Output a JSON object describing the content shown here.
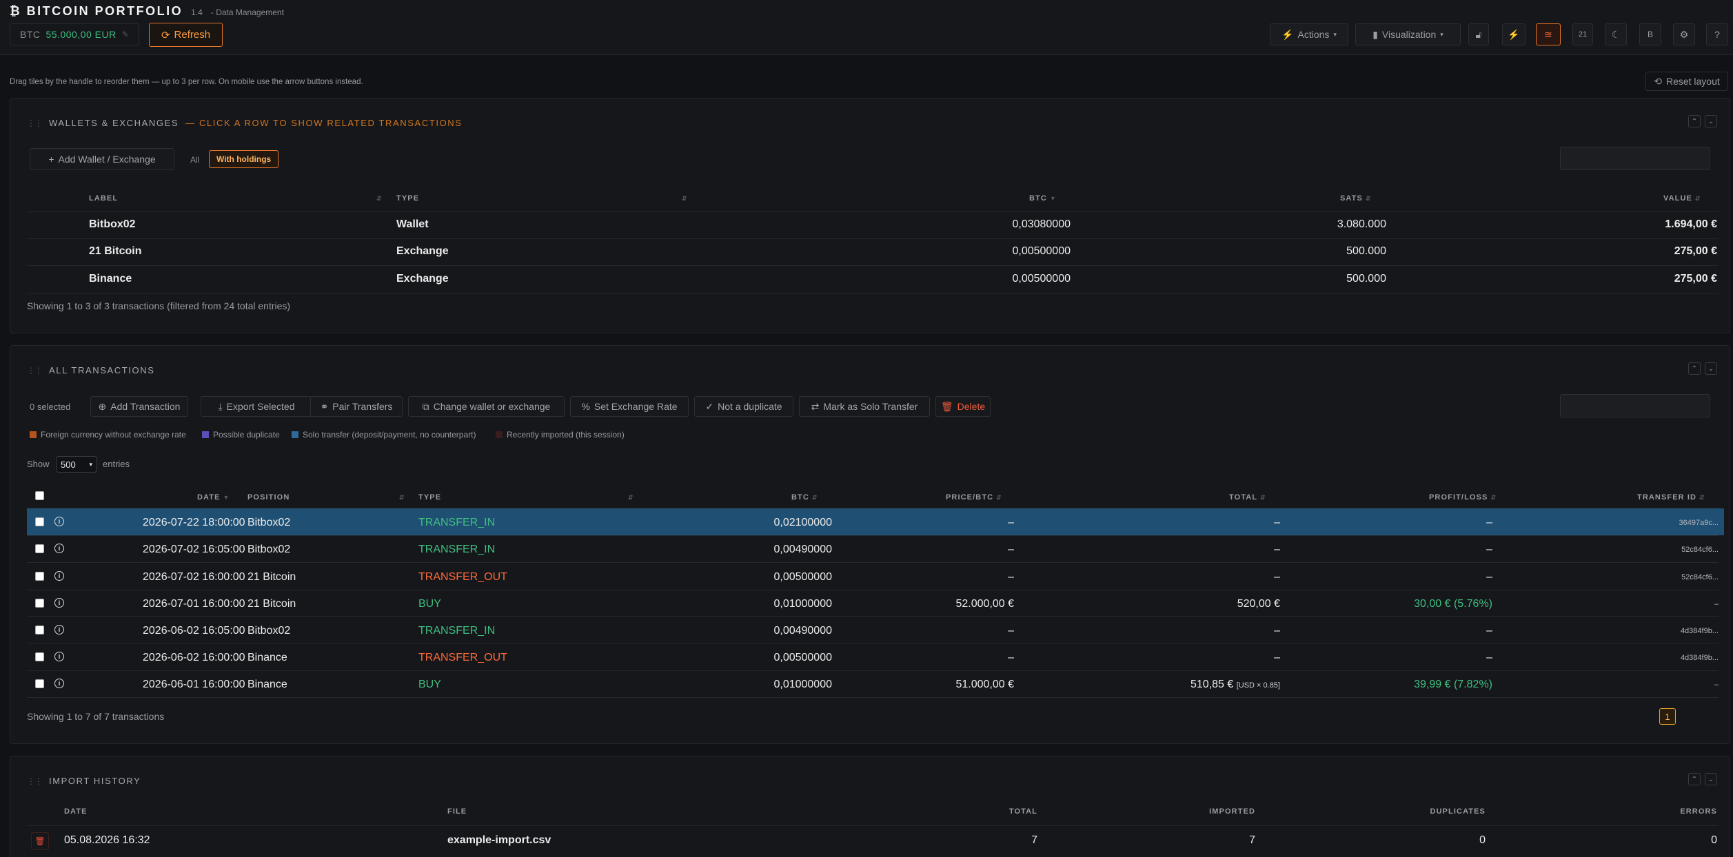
{
  "header": {
    "title": "BITCOIN PORTFOLIO",
    "version": "1.4",
    "subtitle": "- Data Management",
    "btc_label": "BTC",
    "btc_price": "55.000,00 EUR",
    "refresh_label": "Refresh",
    "actions_label": "Actions",
    "visualization_label": "Visualization",
    "badge_21": "21",
    "badge_b": "B",
    "help": "?"
  },
  "hint": {
    "text": "Drag tiles by the handle to reorder them — up to 3 per row. On mobile use the arrow buttons instead.",
    "reset_label": "Reset layout"
  },
  "wallets": {
    "title": "WALLETS & EXCHANGES",
    "hint": "— CLICK A ROW TO SHOW RELATED TRANSACTIONS",
    "add_label": "Add Wallet / Exchange",
    "filter_all": "All",
    "filter_holdings": "With holdings",
    "columns": {
      "label": "LABEL",
      "type": "TYPE",
      "btc": "BTC",
      "sats": "SATS",
      "value": "VALUE"
    },
    "rows": [
      {
        "label": "Bitbox02",
        "type": "Wallet",
        "btc": "0,03080000",
        "sats": "3.080.000",
        "value": "1.694,00 €"
      },
      {
        "label": "21 Bitcoin",
        "type": "Exchange",
        "btc": "0,00500000",
        "sats": "500.000",
        "value": "275,00 €"
      },
      {
        "label": "Binance",
        "type": "Exchange",
        "btc": "0,00500000",
        "sats": "500.000",
        "value": "275,00 €"
      }
    ],
    "footer": "Showing 1 to 3 of 3 transactions (filtered from 24 total entries)"
  },
  "transactions": {
    "title": "ALL TRANSACTIONS",
    "selected": "0 selected",
    "toolbar": {
      "add": "Add Transaction",
      "export": "Export Selected",
      "pair": "Pair Transfers",
      "change": "Change wallet or exchange",
      "rate": "Set Exchange Rate",
      "dup": "Not a duplicate",
      "solo": "Mark as Solo Transfer",
      "delete": "Delete"
    },
    "legend": [
      {
        "label": "Foreign currency without exchange rate",
        "color": "#b5541e"
      },
      {
        "label": "Possible duplicate",
        "color": "#5a4fb5"
      },
      {
        "label": "Solo transfer (deposit/payment, no counterpart)",
        "color": "#2f6a9a"
      },
      {
        "label": "Recently imported (this session)",
        "color": "#3a1d1d"
      }
    ],
    "show_label": "Show",
    "show_value": "500",
    "entries_label": "entries",
    "columns": {
      "date": "DATE",
      "position": "POSITION",
      "type": "TYPE",
      "btc": "BTC",
      "price": "PRICE/BTC",
      "total": "TOTAL",
      "pl": "PROFIT/LOSS",
      "tid": "TRANSFER ID"
    },
    "rows": [
      {
        "date": "2026-07-22 18:00:00",
        "position": "Bitbox02",
        "type": "TRANSFER_IN",
        "btc": "0,02100000",
        "price": "–",
        "total": "–",
        "total_note": "",
        "pl": "–",
        "tid": "36497a9c..."
      },
      {
        "date": "2026-07-02 16:05:00",
        "position": "Bitbox02",
        "type": "TRANSFER_IN",
        "btc": "0,00490000",
        "price": "–",
        "total": "–",
        "total_note": "",
        "pl": "–",
        "tid": "52c84cf6..."
      },
      {
        "date": "2026-07-02 16:00:00",
        "position": "21 Bitcoin",
        "type": "TRANSFER_OUT",
        "btc": "0,00500000",
        "price": "–",
        "total": "–",
        "total_note": "",
        "pl": "–",
        "tid": "52c84cf6..."
      },
      {
        "date": "2026-07-01 16:00:00",
        "position": "21 Bitcoin",
        "type": "BUY",
        "btc": "0,01000000",
        "price": "52.000,00 €",
        "total": "520,00 €",
        "total_note": "",
        "pl": "30,00 € (5.76%)",
        "tid": "–"
      },
      {
        "date": "2026-06-02 16:05:00",
        "position": "Bitbox02",
        "type": "TRANSFER_IN",
        "btc": "0,00490000",
        "price": "–",
        "total": "–",
        "total_note": "",
        "pl": "–",
        "tid": "4d384f9b..."
      },
      {
        "date": "2026-06-02 16:00:00",
        "position": "Binance",
        "type": "TRANSFER_OUT",
        "btc": "0,00500000",
        "price": "–",
        "total": "–",
        "total_note": "",
        "pl": "–",
        "tid": "4d384f9b..."
      },
      {
        "date": "2026-06-01 16:00:00",
        "position": "Binance",
        "type": "BUY",
        "btc": "0,01000000",
        "price": "51.000,00 €",
        "total": "510,85 €",
        "total_note": "[USD × 0.85]",
        "pl": "39,99 € (7.82%)",
        "tid": "–"
      }
    ],
    "footer": "Showing 1 to 7 of 7 transactions",
    "page": "1"
  },
  "imports": {
    "title": "IMPORT HISTORY",
    "columns": {
      "date": "DATE",
      "file": "FILE",
      "total": "TOTAL",
      "imported": "IMPORTED",
      "duplicates": "DUPLICATES",
      "errors": "ERRORS"
    },
    "rows": [
      {
        "date": "05.08.2026 16:32",
        "file": "example-import.csv",
        "total": "7",
        "imported": "7",
        "duplicates": "0",
        "errors": "0"
      }
    ]
  }
}
